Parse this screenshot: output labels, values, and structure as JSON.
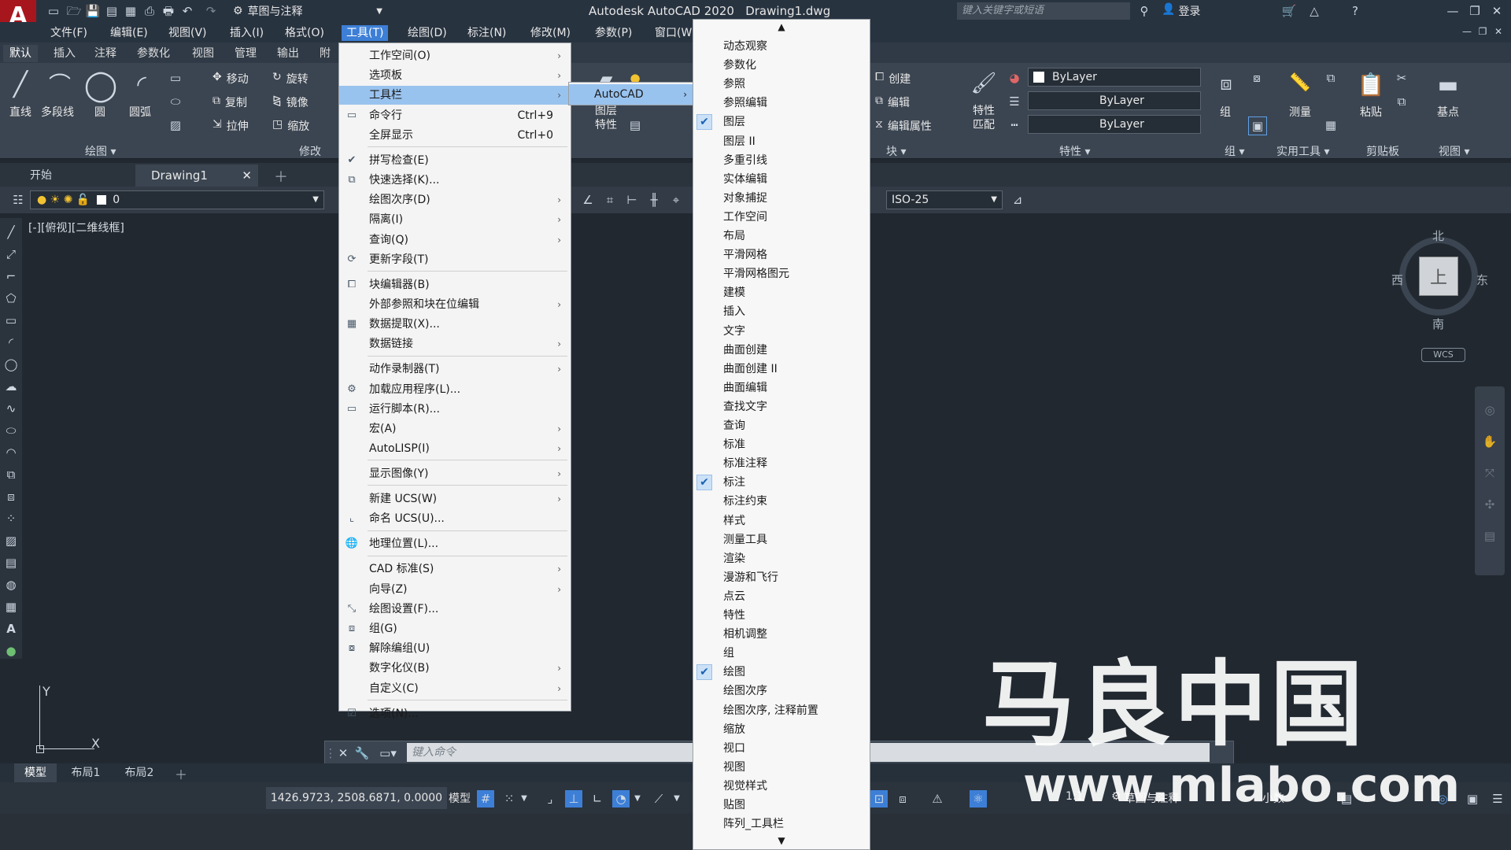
{
  "titlebar": {
    "app_logo": "A",
    "workspace": "草图与注释",
    "title": "Autodesk AutoCAD 2020",
    "file": "Drawing1.dwg",
    "search_placeholder": "键入关键字或短语",
    "login": "登录"
  },
  "menubar": [
    "文件(F)",
    "编辑(E)",
    "视图(V)",
    "插入(I)",
    "格式(O)",
    "工具(T)",
    "绘图(D)",
    "标注(N)",
    "修改(M)",
    "参数(P)",
    "窗口(W)"
  ],
  "ribbon_tabs": [
    "默认",
    "插入",
    "注释",
    "参数化",
    "视图",
    "管理",
    "输出",
    "附"
  ],
  "ribbon": {
    "draw_tools": [
      "直线",
      "多段线",
      "圆",
      "圆弧"
    ],
    "modify_tools": [
      "移动",
      "旋转",
      "复制",
      "镜像",
      "拉伸",
      "缩放"
    ],
    "layer_tools": [
      "图层",
      "特性"
    ],
    "block_tools": [
      "创建",
      "编辑",
      "编辑属性"
    ],
    "match_tool": "特性匹配",
    "bylayer": [
      "ByLayer",
      "ByLayer",
      "ByLayer"
    ],
    "group_tool": "组",
    "measure_tool": "测量",
    "paste_tool": "粘贴",
    "base_tool": "基点",
    "panels": [
      "绘图",
      "修改",
      "块",
      "特性",
      "组",
      "实用工具",
      "剪贴板",
      "视图"
    ]
  },
  "doc_tabs": {
    "start": "开始",
    "drawing": "Drawing1"
  },
  "layer_value": "0",
  "dimstyle": "ISO-25",
  "viewport_label": "[-][俯视][二维线框]",
  "viewcube": {
    "north": "北",
    "south": "南",
    "east": "东",
    "west": "西",
    "top": "上",
    "wcs": "WCS"
  },
  "ucs": {
    "y": "Y",
    "x": "X"
  },
  "command_placeholder": "键入命令",
  "model_tabs": [
    "模型",
    "布局1",
    "布局2"
  ],
  "status": {
    "coords": "1426.9723, 2508.6871, 0.0000",
    "model": "模型",
    "scale": "1:1",
    "workspace": "草图与注释",
    "units": "小数"
  },
  "tools_menu": [
    {
      "label": "工作空间(O)",
      "arrow": true
    },
    {
      "label": "选项板",
      "arrow": true
    },
    {
      "label": "工具栏",
      "arrow": true,
      "highlight": true
    },
    {
      "label": "命令行",
      "shortcut": "Ctrl+9",
      "icon": "cmdline-icon"
    },
    {
      "label": "全屏显示",
      "shortcut": "Ctrl+0",
      "sep": true
    },
    {
      "label": "拼写检查(E)",
      "icon": "spellcheck-icon"
    },
    {
      "label": "快速选择(K)...",
      "icon": "quickselect-icon"
    },
    {
      "label": "绘图次序(D)",
      "arrow": true
    },
    {
      "label": "隔离(I)",
      "arrow": true
    },
    {
      "label": "查询(Q)",
      "arrow": true
    },
    {
      "label": "更新字段(T)",
      "icon": "updatefield-icon",
      "sep": true
    },
    {
      "label": "块编辑器(B)",
      "icon": "blockeditor-icon"
    },
    {
      "label": "外部参照和块在位编辑",
      "arrow": true
    },
    {
      "label": "数据提取(X)...",
      "icon": "dataextract-icon"
    },
    {
      "label": "数据链接",
      "arrow": true,
      "sep": true
    },
    {
      "label": "动作录制器(T)",
      "arrow": true
    },
    {
      "label": "加载应用程序(L)...",
      "icon": "loadapp-icon"
    },
    {
      "label": "运行脚本(R)...",
      "icon": "script-icon"
    },
    {
      "label": "宏(A)",
      "arrow": true
    },
    {
      "label": "AutoLISP(I)",
      "arrow": true,
      "sep": true
    },
    {
      "label": "显示图像(Y)",
      "arrow": true,
      "sep": true
    },
    {
      "label": "新建 UCS(W)",
      "arrow": true
    },
    {
      "label": "命名 UCS(U)...",
      "icon": "ucs-icon",
      "sep": true
    },
    {
      "label": "地理位置(L)...",
      "icon": "globe-icon",
      "sep": true
    },
    {
      "label": "CAD 标准(S)",
      "arrow": true
    },
    {
      "label": "向导(Z)",
      "arrow": true
    },
    {
      "label": "绘图设置(F)...",
      "icon": "draftsettings-icon"
    },
    {
      "label": "组(G)",
      "icon": "group-icon"
    },
    {
      "label": "解除编组(U)",
      "icon": "ungroup-icon"
    },
    {
      "label": "数字化仪(B)",
      "arrow": true
    },
    {
      "label": "自定义(C)",
      "arrow": true,
      "sep": true
    },
    {
      "label": "选项(N)...",
      "icon": "options-check-icon"
    }
  ],
  "toolbar_submenu": {
    "label": "AutoCAD"
  },
  "toolbars_list": [
    {
      "label": "动态观察"
    },
    {
      "label": "参数化"
    },
    {
      "label": "参照"
    },
    {
      "label": "参照编辑"
    },
    {
      "label": "图层",
      "checked": true
    },
    {
      "label": "图层 II"
    },
    {
      "label": "多重引线"
    },
    {
      "label": "实体编辑"
    },
    {
      "label": "对象捕捉"
    },
    {
      "label": "工作空间"
    },
    {
      "label": "布局"
    },
    {
      "label": "平滑网格"
    },
    {
      "label": "平滑网格图元"
    },
    {
      "label": "建模"
    },
    {
      "label": "插入"
    },
    {
      "label": "文字"
    },
    {
      "label": "曲面创建"
    },
    {
      "label": "曲面创建 II"
    },
    {
      "label": "曲面编辑"
    },
    {
      "label": "查找文字"
    },
    {
      "label": "查询"
    },
    {
      "label": "标准"
    },
    {
      "label": "标准注释"
    },
    {
      "label": "标注",
      "checked": true
    },
    {
      "label": "标注约束"
    },
    {
      "label": "样式"
    },
    {
      "label": "测量工具"
    },
    {
      "label": "渲染"
    },
    {
      "label": "漫游和飞行"
    },
    {
      "label": "点云"
    },
    {
      "label": "特性"
    },
    {
      "label": "相机调整"
    },
    {
      "label": "组"
    },
    {
      "label": "绘图",
      "checked": true
    },
    {
      "label": "绘图次序"
    },
    {
      "label": "绘图次序, 注释前置"
    },
    {
      "label": "缩放"
    },
    {
      "label": "视口"
    },
    {
      "label": "视图"
    },
    {
      "label": "视觉样式"
    },
    {
      "label": "贴图"
    },
    {
      "label": "阵列_工具栏"
    }
  ],
  "watermark": {
    "title": "马良中国",
    "url": "www.mlabo.com"
  },
  "colors": {
    "accent": "#3d7fd6",
    "highlight": "#99c3ef",
    "app_red": "#a8161d"
  }
}
